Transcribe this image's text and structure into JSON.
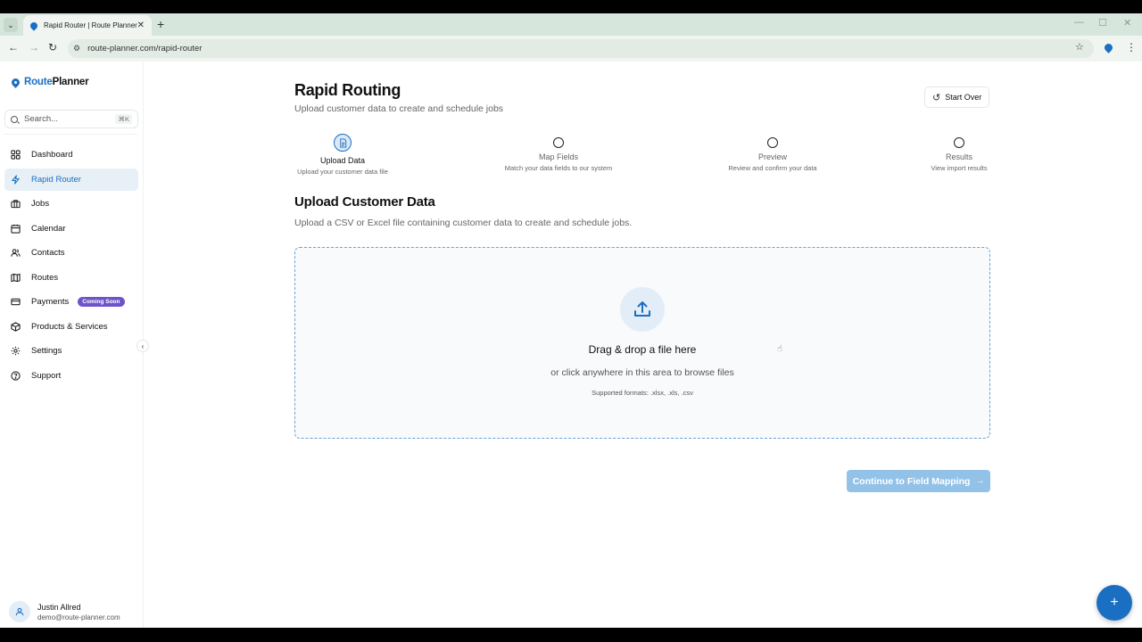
{
  "browser": {
    "tab_title": "Rapid Router | Route Planner",
    "tab_close": "✕",
    "new_tab": "+",
    "url": "route-planner.com/rapid-router"
  },
  "app": {
    "logo_route": "Route",
    "logo_planner": "Planner",
    "accent_color": "#1a6fc2"
  },
  "sidebar": {
    "search_placeholder": "Search...",
    "search_shortcut": "⌘K",
    "items": [
      {
        "label": "Dashboard",
        "icon": "grid-icon"
      },
      {
        "label": "Rapid Router",
        "icon": "lightning-icon",
        "active": true
      },
      {
        "label": "Jobs",
        "icon": "briefcase-icon"
      },
      {
        "label": "Calendar",
        "icon": "calendar-icon"
      },
      {
        "label": "Contacts",
        "icon": "users-icon"
      },
      {
        "label": "Routes",
        "icon": "map-icon"
      },
      {
        "label": "Payments",
        "icon": "credit-card-icon",
        "badge": "Coming Soon"
      },
      {
        "label": "Products & Services",
        "icon": "package-icon"
      },
      {
        "label": "Settings",
        "icon": "gear-icon"
      },
      {
        "label": "Support",
        "icon": "help-circle-icon"
      }
    ],
    "user": {
      "name": "Justin Allred",
      "email": "demo@route-planner.com"
    }
  },
  "page": {
    "title": "Rapid Routing",
    "subtitle": "Upload customer data to create and schedule jobs",
    "start_over": "Start Over"
  },
  "steps": [
    {
      "label": "Upload Data",
      "desc": "Upload your customer data file",
      "state": "active"
    },
    {
      "label": "Map Fields",
      "desc": "Match your data fields to our system",
      "state": "todo"
    },
    {
      "label": "Preview",
      "desc": "Review and confirm your data",
      "state": "todo"
    },
    {
      "label": "Results",
      "desc": "View import results",
      "state": "todo"
    }
  ],
  "upload": {
    "title": "Upload Customer Data",
    "subtitle": "Upload a CSV or Excel file containing customer data to create and schedule jobs.",
    "drop_title": "Drag & drop a file here",
    "drop_sub": "or click anywhere in this area to browse files",
    "formats": "Supported formats: .xlsx, .xls, .csv"
  },
  "actions": {
    "continue": "Continue to Field Mapping",
    "fab": "+"
  }
}
